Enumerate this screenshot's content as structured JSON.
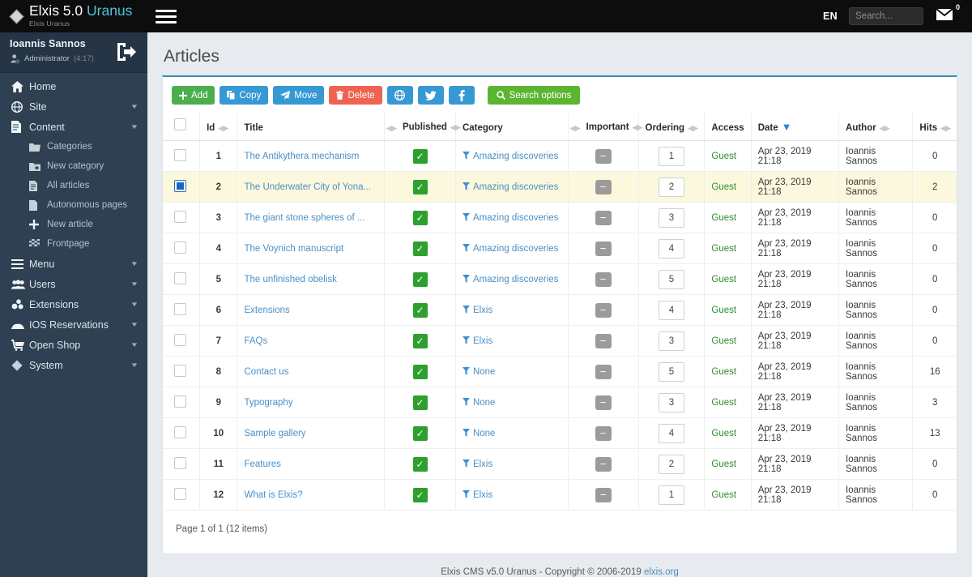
{
  "topbar": {
    "brand_title_main": "Elxis 5.0 ",
    "brand_title_accent": "Uranus",
    "brand_sub": "Elxis Uranus",
    "menu_toggle": "hamburger-menu",
    "language": "EN",
    "search_placeholder": "Search...",
    "search_value": "",
    "mail_badge": "0"
  },
  "sidebar": {
    "user": {
      "name": "Ioannis Sannos",
      "role": "Administrator",
      "session_time": "(4:17)",
      "logout": "logout"
    },
    "items": [
      {
        "label": "Home",
        "icon": "home-icon",
        "caret": ""
      },
      {
        "label": "Site",
        "icon": "globe-icon",
        "caret": "▼"
      },
      {
        "label": "Content",
        "icon": "document-icon",
        "caret": "▼"
      },
      {
        "label": "Menu",
        "icon": "list-icon",
        "caret": "▼"
      },
      {
        "label": "Users",
        "icon": "users-icon",
        "caret": "▼"
      },
      {
        "label": "Extensions",
        "icon": "puzzle-icon",
        "caret": "▼"
      },
      {
        "label": "IOS Reservations",
        "icon": "bed-icon",
        "caret": "▼"
      },
      {
        "label": "Open Shop",
        "icon": "cart-icon",
        "caret": "▼"
      },
      {
        "label": "System",
        "icon": "diamond-icon",
        "caret": "▼"
      }
    ],
    "content_sub": [
      {
        "label": "Categories",
        "icon": "folder-icon"
      },
      {
        "label": "New category",
        "icon": "folder-plus-icon"
      },
      {
        "label": "All articles",
        "icon": "file-icon"
      },
      {
        "label": "Autonomous pages",
        "icon": "file-blank-icon"
      },
      {
        "label": "New article",
        "icon": "plus-icon"
      },
      {
        "label": "Frontpage",
        "icon": "flag-icon"
      }
    ]
  },
  "main": {
    "page_title": "Articles",
    "toolbar": [
      {
        "label": "Add",
        "icon": "plus-icon",
        "style": "green"
      },
      {
        "label": "Copy",
        "icon": "copy-icon",
        "style": "blue"
      },
      {
        "label": "Move",
        "icon": "paper-plane-icon",
        "style": "blue"
      },
      {
        "label": "Delete",
        "icon": "trash-icon",
        "style": "red"
      },
      {
        "label": "",
        "icon": "globe-icon",
        "style": "blue-icon"
      },
      {
        "label": "",
        "icon": "twitter-icon",
        "style": "blue-icon"
      },
      {
        "label": "",
        "icon": "facebook-icon",
        "style": "blue-icon"
      },
      {
        "label": "Search options",
        "icon": "search-icon",
        "style": "searchopt"
      }
    ],
    "columns": [
      {
        "label": "",
        "sortable": false
      },
      {
        "label": "Id",
        "sortable": true
      },
      {
        "label": "Title",
        "sortable": true
      },
      {
        "label": "Published",
        "sortable": true
      },
      {
        "label": "Category",
        "sortable": true
      },
      {
        "label": "Important",
        "sortable": true
      },
      {
        "label": "Ordering",
        "sortable": true
      },
      {
        "label": "Access",
        "sortable": false
      },
      {
        "label": "Date",
        "sortable": true,
        "sorted": "desc"
      },
      {
        "label": "Author",
        "sortable": true
      },
      {
        "label": "Hits",
        "sortable": true
      }
    ],
    "rows": [
      {
        "selected": false,
        "id": "1",
        "title": "The Antikythera mechanism",
        "published": true,
        "category": "Amazing discoveries",
        "important": false,
        "ordering": "1",
        "access": "Guest",
        "date": "Apr 23, 2019 21:18",
        "author": "Ioannis Sannos",
        "hits": "0"
      },
      {
        "selected": true,
        "id": "2",
        "title": "The Underwater City of Yona...",
        "published": true,
        "category": "Amazing discoveries",
        "important": false,
        "ordering": "2",
        "access": "Guest",
        "date": "Apr 23, 2019 21:18",
        "author": "Ioannis Sannos",
        "hits": "2"
      },
      {
        "selected": false,
        "id": "3",
        "title": "The giant stone spheres of ...",
        "published": true,
        "category": "Amazing discoveries",
        "important": false,
        "ordering": "3",
        "access": "Guest",
        "date": "Apr 23, 2019 21:18",
        "author": "Ioannis Sannos",
        "hits": "0"
      },
      {
        "selected": false,
        "id": "4",
        "title": "The Voynich manuscript",
        "published": true,
        "category": "Amazing discoveries",
        "important": false,
        "ordering": "4",
        "access": "Guest",
        "date": "Apr 23, 2019 21:18",
        "author": "Ioannis Sannos",
        "hits": "0"
      },
      {
        "selected": false,
        "id": "5",
        "title": "The unfinished obelisk",
        "published": true,
        "category": "Amazing discoveries",
        "important": false,
        "ordering": "5",
        "access": "Guest",
        "date": "Apr 23, 2019 21:18",
        "author": "Ioannis Sannos",
        "hits": "0"
      },
      {
        "selected": false,
        "id": "6",
        "title": "Extensions",
        "published": true,
        "category": "Elxis",
        "important": false,
        "ordering": "4",
        "access": "Guest",
        "date": "Apr 23, 2019 21:18",
        "author": "Ioannis Sannos",
        "hits": "0"
      },
      {
        "selected": false,
        "id": "7",
        "title": "FAQs",
        "published": true,
        "category": "Elxis",
        "important": false,
        "ordering": "3",
        "access": "Guest",
        "date": "Apr 23, 2019 21:18",
        "author": "Ioannis Sannos",
        "hits": "0"
      },
      {
        "selected": false,
        "id": "8",
        "title": "Contact us",
        "published": true,
        "category": "None",
        "important": false,
        "ordering": "5",
        "access": "Guest",
        "date": "Apr 23, 2019 21:18",
        "author": "Ioannis Sannos",
        "hits": "16"
      },
      {
        "selected": false,
        "id": "9",
        "title": "Typography",
        "published": true,
        "category": "None",
        "important": false,
        "ordering": "3",
        "access": "Guest",
        "date": "Apr 23, 2019 21:18",
        "author": "Ioannis Sannos",
        "hits": "3"
      },
      {
        "selected": false,
        "id": "10",
        "title": "Sample gallery",
        "published": true,
        "category": "None",
        "important": false,
        "ordering": "4",
        "access": "Guest",
        "date": "Apr 23, 2019 21:18",
        "author": "Ioannis Sannos",
        "hits": "13"
      },
      {
        "selected": false,
        "id": "11",
        "title": "Features",
        "published": true,
        "category": "Elxis",
        "important": false,
        "ordering": "2",
        "access": "Guest",
        "date": "Apr 23, 2019 21:18",
        "author": "Ioannis Sannos",
        "hits": "0"
      },
      {
        "selected": false,
        "id": "12",
        "title": "What is Elxis?",
        "published": true,
        "category": "Elxis",
        "important": false,
        "ordering": "1",
        "access": "Guest",
        "date": "Apr 23, 2019 21:18",
        "author": "Ioannis Sannos",
        "hits": "0"
      }
    ],
    "pager": "Page 1 of 1 (12 items)",
    "footer_text": "Elxis CMS v5.0 Uranus - Copyright © 2006-2019 ",
    "footer_link": "elxis.org"
  },
  "colors": {
    "topbar_bg": "#0d0d0d",
    "sidebar_bg": "#2e4052",
    "accent_blue": "#3c8dbc",
    "brand_accent": "#4fc3dd",
    "green": "#4cae4c",
    "blue": "#3699d3",
    "red": "#ef6351",
    "selected_row": "#fcf8dd",
    "published_green": "#2da02d"
  }
}
